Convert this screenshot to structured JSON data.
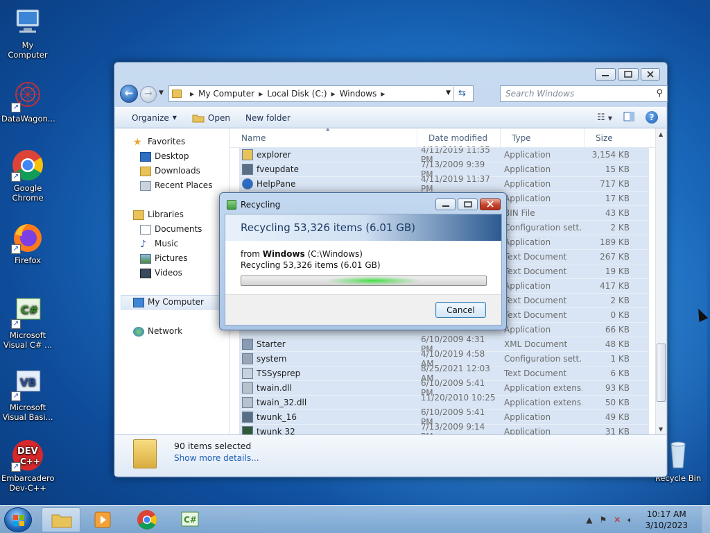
{
  "desktop": {
    "icons": [
      {
        "label": "My Computer"
      },
      {
        "label": "DataWagon..."
      },
      {
        "label": "Google Chrome"
      },
      {
        "label": "Firefox"
      },
      {
        "label": "Microsoft Visual C# ..."
      },
      {
        "label": "Microsoft Visual Basi..."
      },
      {
        "label": "Embarcadero Dev-C++"
      },
      {
        "label": "Recycle Bin"
      }
    ]
  },
  "explorer": {
    "breadcrumb": [
      "My Computer",
      "Local Disk (C:)",
      "Windows"
    ],
    "search_placeholder": "Search Windows",
    "toolbar": {
      "organize": "Organize",
      "open": "Open",
      "new_folder": "New folder"
    },
    "nav": {
      "favorites": "Favorites",
      "desktop": "Desktop",
      "downloads": "Downloads",
      "recent_places": "Recent Places",
      "libraries": "Libraries",
      "documents": "Documents",
      "music": "Music",
      "pictures": "Pictures",
      "videos": "Videos",
      "my_computer": "My Computer",
      "network": "Network"
    },
    "columns": {
      "name": "Name",
      "date": "Date modified",
      "type": "Type",
      "size": "Size"
    },
    "rows": [
      {
        "name": "explorer",
        "date": "4/11/2019 11:35 PM",
        "type": "Application",
        "size": "3,154 KB"
      },
      {
        "name": "fveupdate",
        "date": "7/13/2009 9:39 PM",
        "type": "Application",
        "size": "15 KB"
      },
      {
        "name": "HelpPane",
        "date": "4/11/2019 11:37 PM",
        "type": "Application",
        "size": "717 KB"
      },
      {
        "name": "",
        "date": "",
        "type": "Application",
        "size": "17 KB"
      },
      {
        "name": "",
        "date": "",
        "type": "BIN File",
        "size": "43 KB"
      },
      {
        "name": "",
        "date": "",
        "type": "Configuration sett...",
        "size": "2 KB"
      },
      {
        "name": "",
        "date": "",
        "type": "Application",
        "size": "189 KB"
      },
      {
        "name": "",
        "date": "",
        "type": "Text Document",
        "size": "267 KB"
      },
      {
        "name": "",
        "date": "",
        "type": "Text Document",
        "size": "19 KB"
      },
      {
        "name": "",
        "date": "",
        "type": "Application",
        "size": "417 KB"
      },
      {
        "name": "",
        "date": "",
        "type": "Text Document",
        "size": "2 KB"
      },
      {
        "name": "",
        "date": "",
        "type": "Text Document",
        "size": "0 KB"
      },
      {
        "name": "",
        "date": "",
        "type": "Application",
        "size": "66 KB"
      },
      {
        "name": "Starter",
        "date": "6/10/2009 4:31 PM",
        "type": "XML Document",
        "size": "48 KB"
      },
      {
        "name": "system",
        "date": "4/10/2019 4:58 AM",
        "type": "Configuration sett...",
        "size": "1 KB"
      },
      {
        "name": "TSSysprep",
        "date": "8/25/2021 12:03 AM",
        "type": "Text Document",
        "size": "6 KB"
      },
      {
        "name": "twain.dll",
        "date": "6/10/2009 5:41 PM",
        "type": "Application extens...",
        "size": "93 KB"
      },
      {
        "name": "twain_32.dll",
        "date": "11/20/2010 10:25 ...",
        "type": "Application extens...",
        "size": "50 KB"
      },
      {
        "name": "twunk_16",
        "date": "6/10/2009 5:41 PM",
        "type": "Application",
        "size": "49 KB"
      },
      {
        "name": "twunk 32",
        "date": "7/13/2009 9:14 PM",
        "type": "Application",
        "size": "31 KB"
      }
    ],
    "details": {
      "selected": "90 items selected",
      "more": "Show more details..."
    }
  },
  "dialog": {
    "title": "Recycling",
    "banner": "Recycling 53,326 items (6.01 GB)",
    "from_prefix": "from",
    "from_name": "Windows",
    "from_path": "(C:\\Windows)",
    "sub": "Recycling 53,326 items (6.01 GB)",
    "cancel": "Cancel"
  },
  "taskbar": {
    "time": "10:17 AM",
    "date": "3/10/2023"
  }
}
